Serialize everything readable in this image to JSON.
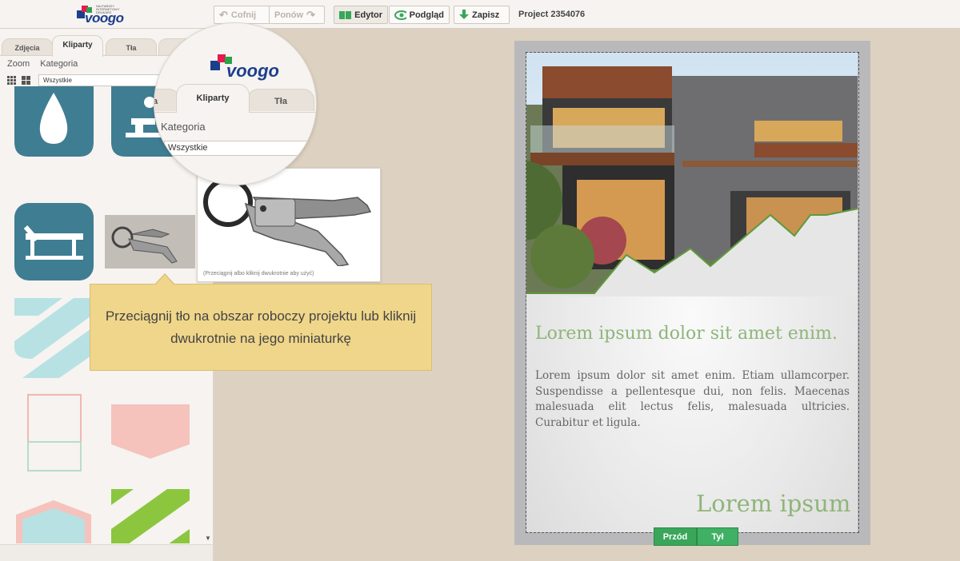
{
  "header": {
    "logo_text": "voogo",
    "logo_tagline": "NAJTAŃSZY INTERNETOWY DRUKARZ",
    "undo_label": "Cofnij",
    "redo_label": "Ponów",
    "editor_label": "Edytor",
    "preview_label": "Podgląd",
    "save_label": "Zapisz",
    "project_label": "Project 2354076"
  },
  "sidebar": {
    "tabs": [
      "Zdjęcia",
      "Kliparty",
      "Tła"
    ],
    "active_tab": "Kliparty",
    "menu": [
      "Zoom",
      "Kategoria"
    ],
    "category_value": "Wszystkie"
  },
  "magnifier": {
    "tabs": [
      "a",
      "Kliparty",
      "Tła"
    ],
    "category_label": "Kategoria",
    "category_value": "Wszystkie"
  },
  "preview_popup": {
    "hint": "(Przeciągnij albo kliknij dwukrotnie aby użyć)"
  },
  "tooltip": {
    "text": "Przeciągnij tło na obszar roboczy projektu lub kliknij dwukrotnie na jego miniaturkę"
  },
  "canvas": {
    "headline": "Lorem ipsum dolor sit amet enim.",
    "body": "Lorem ipsum dolor sit amet enim. Etiam ullamcorper. Suspendisse a pellentesque dui, non felis. Maecenas malesuada elit lectus felis, malesuada ultricies. Curabitur et ligula.",
    "footer_title": "Lorem ipsum",
    "front_label": "Przód",
    "back_label": "Tył"
  },
  "colors": {
    "accent_green": "#3aa65a",
    "clipart_teal": "#3f7d93",
    "title_green": "#8fb57a",
    "tooltip_bg": "#f0d68a"
  }
}
